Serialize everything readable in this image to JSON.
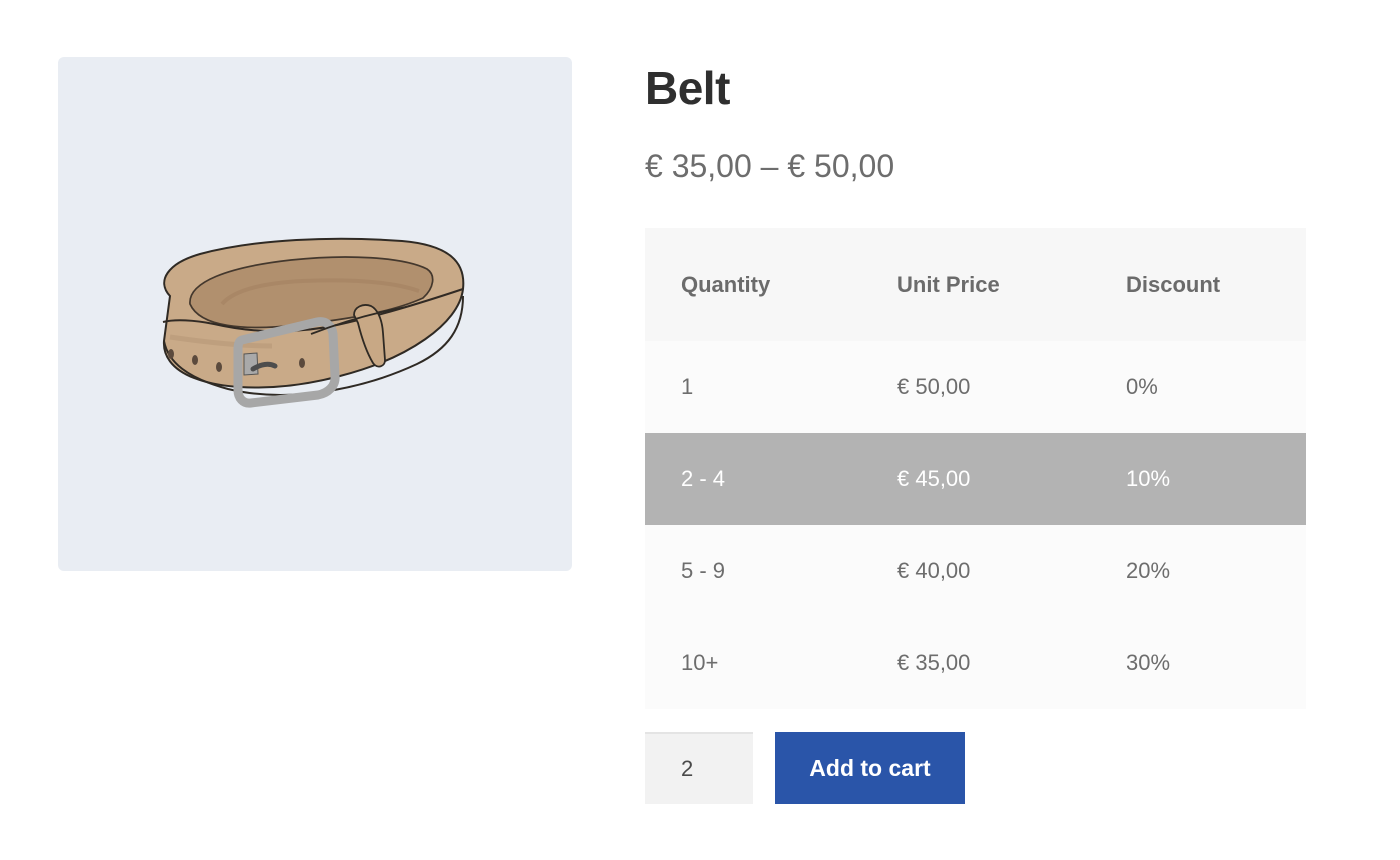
{
  "product": {
    "title": "Belt",
    "price_range": "€ 35,00 – € 50,00",
    "image": {
      "background_color": "#e9edf3",
      "belt_color": "#c7a886",
      "buckle_color": "#a5a5a5"
    }
  },
  "pricing_table": {
    "headers": [
      "Quantity",
      "Unit Price",
      "Discount"
    ],
    "rows": [
      {
        "quantity": "1",
        "unit_price": "€ 50,00",
        "discount": "0%"
      },
      {
        "quantity": "2 - 4",
        "unit_price": "€ 45,00",
        "discount": "10%"
      },
      {
        "quantity": "5 - 9",
        "unit_price": "€ 40,00",
        "discount": "20%"
      },
      {
        "quantity": "10+",
        "unit_price": "€ 35,00",
        "discount": "30%"
      }
    ],
    "highlight_color": "#b3b3b3"
  },
  "cart": {
    "quantity_value": "2",
    "add_to_cart_label": "Add to cart",
    "button_color": "#2a55a9"
  }
}
